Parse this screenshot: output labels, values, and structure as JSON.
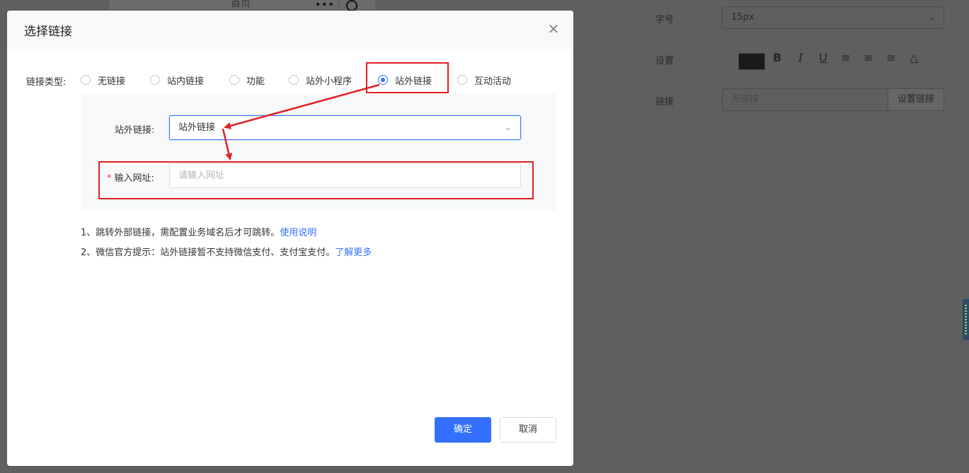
{
  "background": {
    "preview_title": "首页",
    "panel": {
      "font_size_label": "字号",
      "font_size_value": "15px",
      "settings_label": "设置",
      "link_label": "链接",
      "link_placeholder": "无链接",
      "set_link_button": "设置链接",
      "format_buttons": [
        "B",
        "I",
        "U",
        "align-left-icon",
        "align-center-icon",
        "align-right-icon",
        "strikethrough-icon"
      ]
    }
  },
  "modal": {
    "title": "选择链接",
    "link_type_label": "链接类型:",
    "link_types": [
      {
        "label": "无链接",
        "checked": false
      },
      {
        "label": "站内链接",
        "checked": false
      },
      {
        "label": "功能",
        "checked": false
      },
      {
        "label": "站外小程序",
        "checked": false
      },
      {
        "label": "站外链接",
        "checked": true
      },
      {
        "label": "互动活动",
        "checked": false
      }
    ],
    "external_link_label": "站外链接:",
    "external_link_value": "站外链接",
    "url_label": "输入网址:",
    "url_required_mark": "*",
    "url_placeholder": "请输入网址",
    "tips": [
      {
        "text": "1、跳转外部链接，需配置业务域名后才可跳转。",
        "link": "使用说明"
      },
      {
        "text": "2、微信官方提示：站外链接暂不支持微信支付、支付宝支付。",
        "link": "了解更多"
      }
    ],
    "confirm_button": "确定",
    "cancel_button": "取消"
  },
  "colors": {
    "primary": "#3370ff",
    "annotation": "#e02020",
    "required": "#e34d59"
  }
}
